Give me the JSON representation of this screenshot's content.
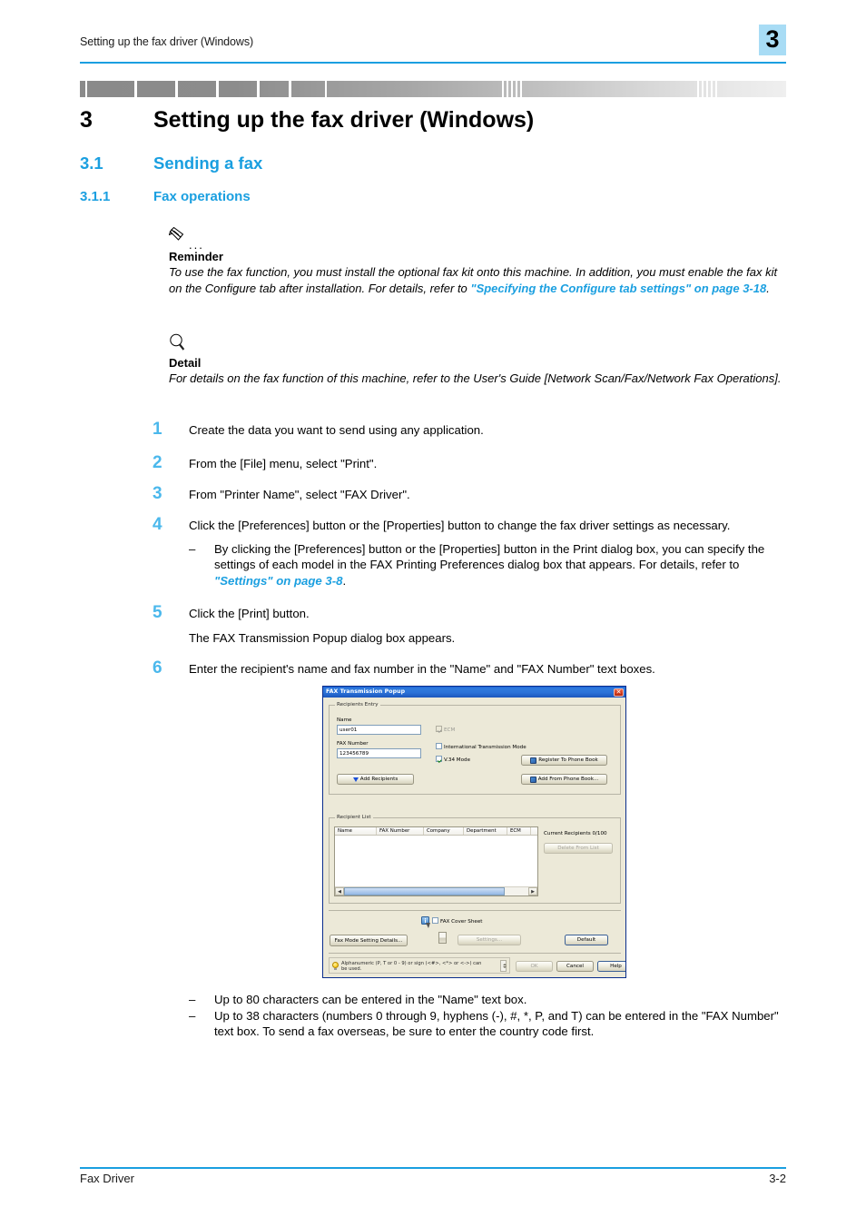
{
  "page": {
    "running_header": "Setting up the fax driver (Windows)",
    "chapter_badge": "3",
    "footer_left": "Fax Driver",
    "footer_right": "3-2"
  },
  "headings": {
    "h1_number": "3",
    "h1_title": "Setting up the fax driver (Windows)",
    "h2_number": "3.1",
    "h2_title": "Sending a fax",
    "h3_number": "3.1.1",
    "h3_title": "Fax operations"
  },
  "notes": {
    "reminder": {
      "dots": "...",
      "title": "Reminder",
      "text_before": "To use the fax function, you must install the optional fax kit onto this machine. In addition, you must enable the fax kit on the Configure tab after installation. For details, refer to ",
      "xref": "\"Specifying the Configure tab settings\" on page 3-18",
      "text_after": "."
    },
    "detail": {
      "title": "Detail",
      "text": "For details on the fax function of this machine, refer to the User's Guide [Network Scan/Fax/Network Fax Operations]."
    }
  },
  "steps": [
    {
      "number": "1",
      "text": "Create the data you want to send using any application."
    },
    {
      "number": "2",
      "text": "From the [File] menu, select \"Print\"."
    },
    {
      "number": "3",
      "text": "From \"Printer Name\", select \"FAX Driver\"."
    },
    {
      "number": "4",
      "text": "Click the [Preferences] button or the [Properties] button to change the fax driver settings as necessary.",
      "sub_dash": "–",
      "sub_text_before": "By clicking the [Preferences] button or the [Properties] button in the Print dialog box, you can specify the settings of each model in the FAX Printing Preferences dialog box that appears. For details, refer to ",
      "sub_xref": "\"Settings\" on page 3-8",
      "sub_text_after": "."
    },
    {
      "number": "5",
      "text": "Click the [Print] button.",
      "extra": "The FAX Transmission Popup dialog box appears."
    },
    {
      "number": "6",
      "text": "Enter the recipient's name and fax number in the \"Name\" and \"FAX Number\" text boxes."
    }
  ],
  "tail_bullets": [
    {
      "dash": "–",
      "text": "Up to 80 characters can be entered in the \"Name\" text box."
    },
    {
      "dash": "–",
      "text": "Up to 38 characters (numbers 0 through 9, hyphens (-), #, *, P, and T) can be entered in the \"FAX Number\" text box. To send a fax overseas, be sure to enter the country code first."
    }
  ],
  "dialog": {
    "title": "FAX Transmission Popup",
    "close_glyph": "✕",
    "recipients_entry": {
      "group_label": "Recipients Entry",
      "name_label": "Name",
      "name_value": "user01",
      "fax_number_label": "FAX Number",
      "fax_number_value": "123456789",
      "ecm_label": "ECM",
      "international_label": "International Transmission Mode",
      "v34_label": "V.34 Mode",
      "add_recipients_button": "Add Recipients",
      "register_phonebook_button": "Register To Phone Book",
      "add_from_phonebook_button": "Add From Phone Book..."
    },
    "recipient_list": {
      "group_label": "Recipient List",
      "columns": [
        "Name",
        "FAX Number",
        "Company",
        "Department",
        "ECM"
      ],
      "rows": [],
      "current_recipients": "Current Recipients 0/100",
      "delete_from_list_button": "Delete From List",
      "scroll_left_glyph": "◀",
      "scroll_right_glyph": "▶"
    },
    "bottom": {
      "cover_sheet_label": "FAX Cover Sheet",
      "info_glyph": "i",
      "fax_mode_button": "Fax Mode Setting Details...",
      "settings_button": "Settings...",
      "default_button": "Default",
      "hint_text": "Alphanumeric (P, T or 0 - 9) or sign (<#>, <*> or <->) can be used.",
      "ok_button": "OK",
      "cancel_button": "Cancel",
      "help_button": "Help"
    }
  }
}
